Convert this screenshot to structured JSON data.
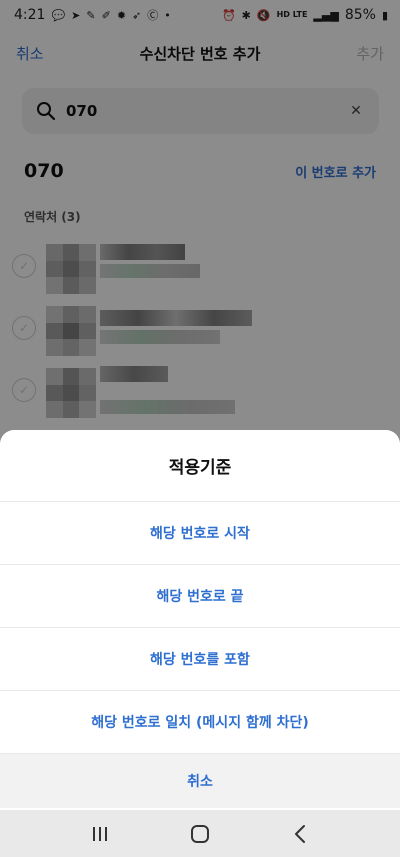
{
  "status_bar": {
    "time": "4:21",
    "battery": "85%",
    "network": "HD LTE",
    "dot": "•"
  },
  "header": {
    "cancel": "취소",
    "title": "수신차단 번호 추가",
    "add": "추가"
  },
  "search": {
    "value": "070"
  },
  "number_row": {
    "number": "070",
    "add_label": "이 번호로 추가"
  },
  "contacts": {
    "header": "연락처 (3)"
  },
  "sheet": {
    "title": "적용기준",
    "options": [
      "해당 번호로 시작",
      "해당 번호로 끝",
      "해당 번호를 포함",
      "해당 번호로 일치 (메시지 함께 차단)"
    ],
    "cancel": "취소"
  },
  "colors": {
    "accent": "#2f6fd0",
    "overlay": "rgba(0,0,0,0.45)"
  },
  "icons": {
    "search": "search-icon",
    "clear": "close-icon",
    "check": "check-icon",
    "recents": "recents-icon",
    "home": "home-icon",
    "back": "back-icon"
  }
}
